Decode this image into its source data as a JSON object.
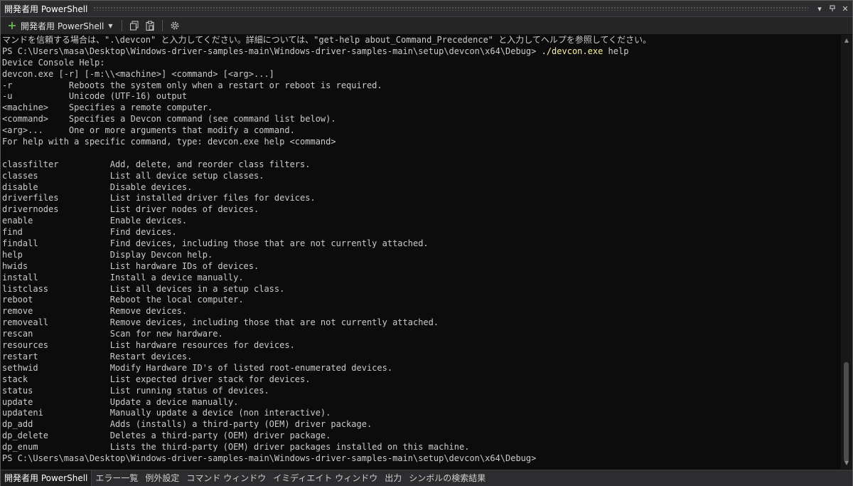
{
  "window": {
    "title": "開発者用 PowerShell"
  },
  "toolbar": {
    "new_tab_label": "開発者用 PowerShell"
  },
  "console": {
    "lines": [
      {
        "text": "マンドを信頼する場合は、\".\\devcon\" と入力してください。詳細については、\"get-help about_Command_Precedence\" と入力してヘルプを参照してください。"
      },
      {
        "prompt": "PS C:\\Users\\masa\\Desktop\\Windows-driver-samples-main\\Windows-driver-samples-main\\setup\\devcon\\x64\\Debug> ",
        "cmd": "./devcon.exe",
        "arg": " help"
      },
      {
        "text": "Device Console Help:"
      },
      {
        "text": "devcon.exe [-r] [-m:\\\\<machine>] <command> [<arg>...]"
      },
      {
        "text": "-r           Reboots the system only when a restart or reboot is required."
      },
      {
        "text": "-u           Unicode (UTF-16) output"
      },
      {
        "text": "<machine>    Specifies a remote computer."
      },
      {
        "text": "<command>    Specifies a Devcon command (see command list below)."
      },
      {
        "text": "<arg>...     One or more arguments that modify a command."
      },
      {
        "text": "For help with a specific command, type: devcon.exe help <command>"
      },
      {
        "text": ""
      },
      {
        "text": "classfilter          Add, delete, and reorder class filters."
      },
      {
        "text": "classes              List all device setup classes."
      },
      {
        "text": "disable              Disable devices."
      },
      {
        "text": "driverfiles          List installed driver files for devices."
      },
      {
        "text": "drivernodes          List driver nodes of devices."
      },
      {
        "text": "enable               Enable devices."
      },
      {
        "text": "find                 Find devices."
      },
      {
        "text": "findall              Find devices, including those that are not currently attached."
      },
      {
        "text": "help                 Display Devcon help."
      },
      {
        "text": "hwids                List hardware IDs of devices."
      },
      {
        "text": "install              Install a device manually."
      },
      {
        "text": "listclass            List all devices in a setup class."
      },
      {
        "text": "reboot               Reboot the local computer."
      },
      {
        "text": "remove               Remove devices."
      },
      {
        "text": "removeall            Remove devices, including those that are not currently attached."
      },
      {
        "text": "rescan               Scan for new hardware."
      },
      {
        "text": "resources            List hardware resources for devices."
      },
      {
        "text": "restart              Restart devices."
      },
      {
        "text": "sethwid              Modify Hardware ID's of listed root-enumerated devices."
      },
      {
        "text": "stack                List expected driver stack for devices."
      },
      {
        "text": "status               List running status of devices."
      },
      {
        "text": "update               Update a device manually."
      },
      {
        "text": "updateni             Manually update a device (non interactive)."
      },
      {
        "text": "dp_add               Adds (installs) a third-party (OEM) driver package."
      },
      {
        "text": "dp_delete            Deletes a third-party (OEM) driver package."
      },
      {
        "text": "dp_enum              Lists the third-party (OEM) driver packages installed on this machine."
      },
      {
        "text": "PS C:\\Users\\masa\\Desktop\\Windows-driver-samples-main\\Windows-driver-samples-main\\setup\\devcon\\x64\\Debug>"
      }
    ]
  },
  "bottom_tabs": [
    {
      "label": "開発者用 PowerShell",
      "active": true
    },
    {
      "label": "エラー一覧"
    },
    {
      "label": "例外設定"
    },
    {
      "label": "コマンド ウィンドウ"
    },
    {
      "label": "イミディエイト ウィンドウ"
    },
    {
      "label": "出力"
    },
    {
      "label": "シンボルの検索結果"
    }
  ],
  "icons": {
    "new_tab": "plus-icon",
    "copy": "copy-icon",
    "paste": "clipboard-icon",
    "settings": "gear-icon",
    "dropdown": "chevron-down-icon",
    "pin": "pin-icon",
    "close": "close-icon"
  },
  "colors": {
    "console_bg": "#0c0c0c",
    "command_highlight": "#f9f1a5",
    "accent_green": "#6ab04c"
  }
}
